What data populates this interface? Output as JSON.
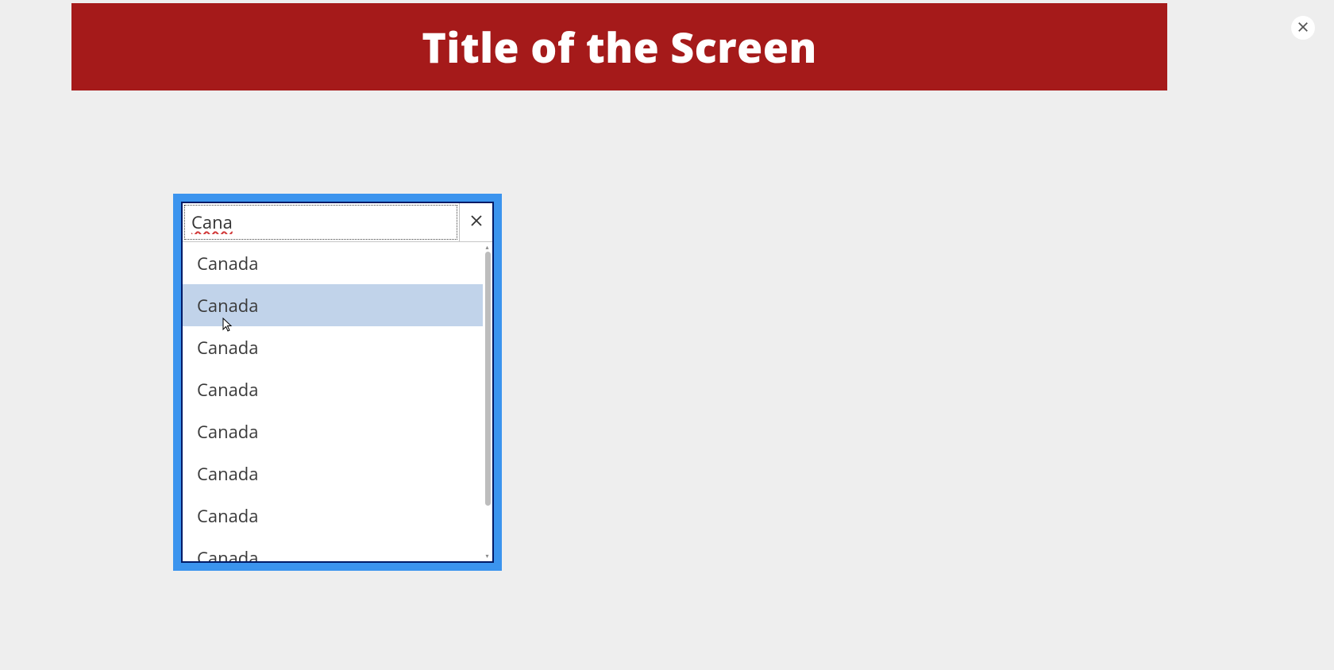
{
  "header": {
    "title": "Title of the Screen"
  },
  "combobox": {
    "input_value": "Cana",
    "clear_icon": "x-icon",
    "highlighted_index": 1,
    "options": [
      {
        "label": "Canada"
      },
      {
        "label": "Canada"
      },
      {
        "label": "Canada"
      },
      {
        "label": "Canada"
      },
      {
        "label": "Canada"
      },
      {
        "label": "Canada"
      },
      {
        "label": "Canada"
      },
      {
        "label": "Canada"
      }
    ]
  }
}
